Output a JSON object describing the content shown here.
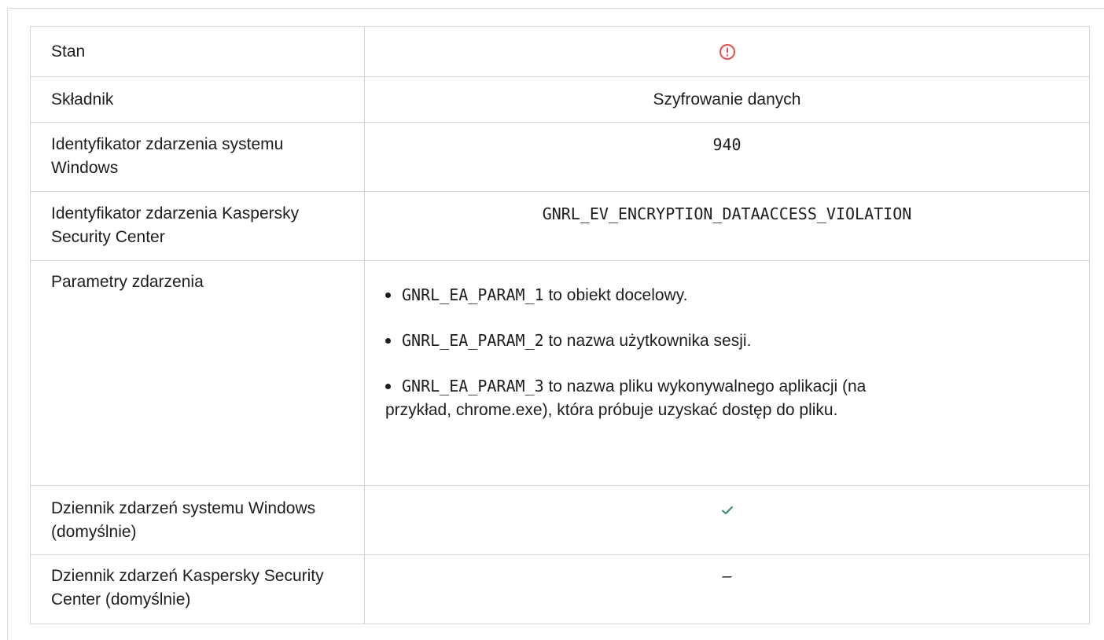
{
  "rows": {
    "status": {
      "label": "Stan",
      "icon": "alert-circle-icon",
      "icon_color": "#e94e4e"
    },
    "component": {
      "label": "Składnik",
      "value": "Szyfrowanie danych"
    },
    "windows_event_id": {
      "label": "Identyfikator zdarzenia systemu Windows",
      "value": "940"
    },
    "ksc_event_id": {
      "label": "Identyfikator zdarzenia Kaspersky Security Center",
      "value": "GNRL_EV_ENCRYPTION_DATAACCESS_VIOLATION"
    },
    "event_params": {
      "label": "Parametry zdarzenia",
      "items": [
        {
          "code": "GNRL_EA_PARAM_1",
          "text": " to obiekt docelowy."
        },
        {
          "code": "GNRL_EA_PARAM_2",
          "text": " to nazwa użytkownika sesji."
        },
        {
          "code": "GNRL_EA_PARAM_3",
          "text": " to nazwa pliku wykonywalnego aplikacji (na",
          "cont": "przykład, chrome.exe), która próbuje uzyskać dostęp do pliku."
        }
      ]
    },
    "windows_log": {
      "label": "Dziennik zdarzeń systemu Windows (domyślnie)",
      "icon": "checkmark-icon",
      "icon_color": "#2e8b6e"
    },
    "ksc_log": {
      "label": "Dziennik zdarzeń Kaspersky Security Center (domyślnie)",
      "value": "–"
    }
  }
}
